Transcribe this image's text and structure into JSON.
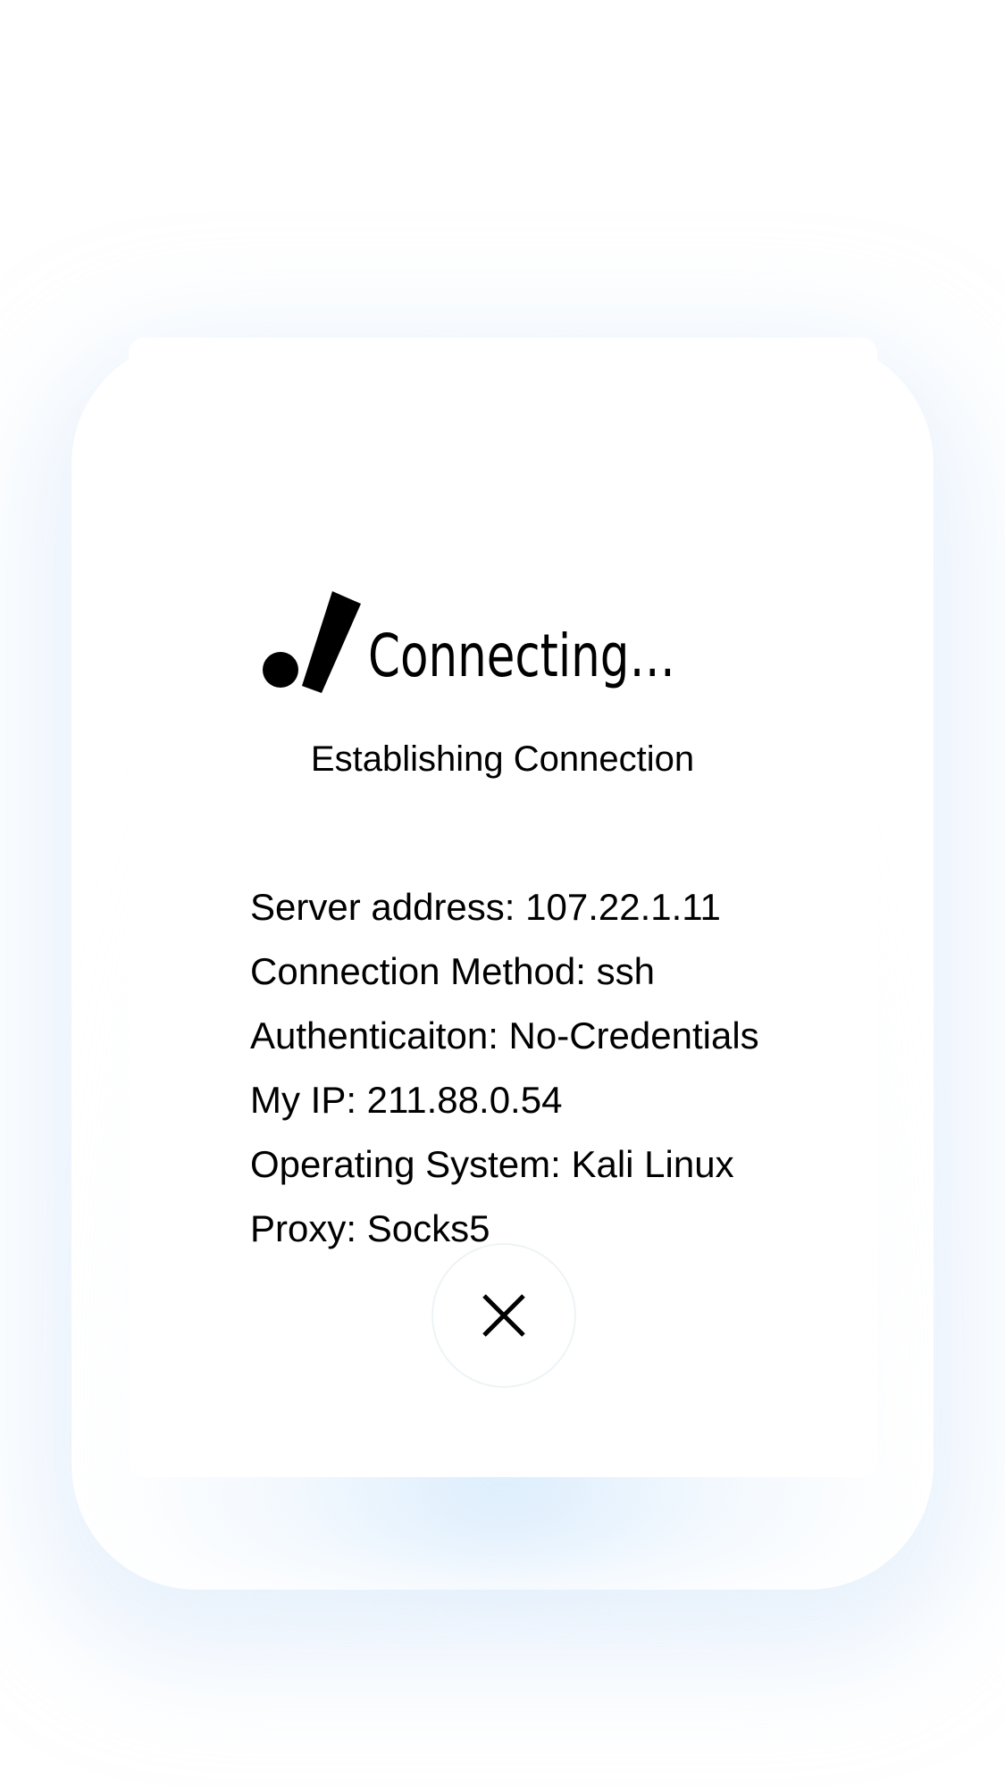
{
  "dialog": {
    "status_title": "Connecting…",
    "status_subtitle": "Establishing Connection",
    "details": [
      "Server address: 107.22.1.11",
      "Connection Method: ssh",
      "Authenticaiton: No-Credentials",
      "My IP: 211.88.0.54",
      "Operating System: Kali Linux",
      "Proxy: Socks5"
    ],
    "close_icon": "close-icon",
    "brand_icon": "dot-slash-logo-icon"
  },
  "colors": {
    "background": "#ffffff",
    "card": "#ffffff",
    "glow": "#d6eafc",
    "text": "#000000",
    "button_border": "#eef3f6"
  }
}
